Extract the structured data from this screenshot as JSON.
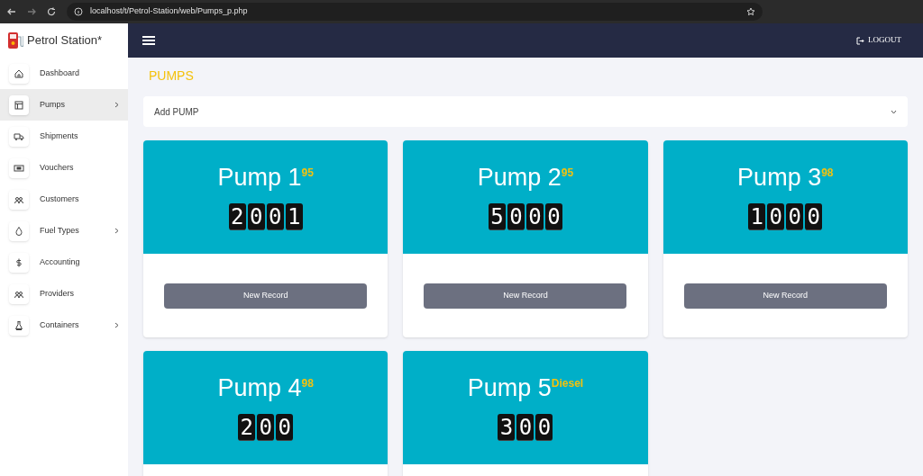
{
  "browser": {
    "url": "localhost/t/Petrol-Station/web/Pumps_p.php"
  },
  "sidebar": {
    "brand": "Petrol Station*",
    "items": [
      {
        "label": "Dashboard",
        "selected": false,
        "has_submenu": false
      },
      {
        "label": "Pumps",
        "selected": true,
        "has_submenu": true
      },
      {
        "label": "Shipments",
        "selected": false,
        "has_submenu": false
      },
      {
        "label": "Vouchers",
        "selected": false,
        "has_submenu": false
      },
      {
        "label": "Customers",
        "selected": false,
        "has_submenu": false
      },
      {
        "label": "Fuel Types",
        "selected": false,
        "has_submenu": true
      },
      {
        "label": "Accounting",
        "selected": false,
        "has_submenu": false
      },
      {
        "label": "Providers",
        "selected": false,
        "has_submenu": false
      },
      {
        "label": "Containers",
        "selected": false,
        "has_submenu": true
      }
    ]
  },
  "header": {
    "logout": "LOGOUT"
  },
  "page_title": "PUMPS",
  "add_panel": {
    "label": "Add PUMP",
    "expanded": false
  },
  "pumps": [
    {
      "name": "Pump 1",
      "fuel": "95",
      "digits": [
        "2",
        "0",
        "0",
        "1"
      ],
      "button": "New Record"
    },
    {
      "name": "Pump 2",
      "fuel": "95",
      "digits": [
        "5",
        "0",
        "0",
        "0"
      ],
      "button": "New Record"
    },
    {
      "name": "Pump 3",
      "fuel": "98",
      "digits": [
        "1",
        "0",
        "0",
        "0"
      ],
      "button": "New Record"
    },
    {
      "name": "Pump 4",
      "fuel": "98",
      "digits": [
        "2",
        "0",
        "0"
      ]
    },
    {
      "name": "Pump 5",
      "fuel": "Diesel",
      "digits": [
        "3",
        "0",
        "0"
      ]
    }
  ]
}
